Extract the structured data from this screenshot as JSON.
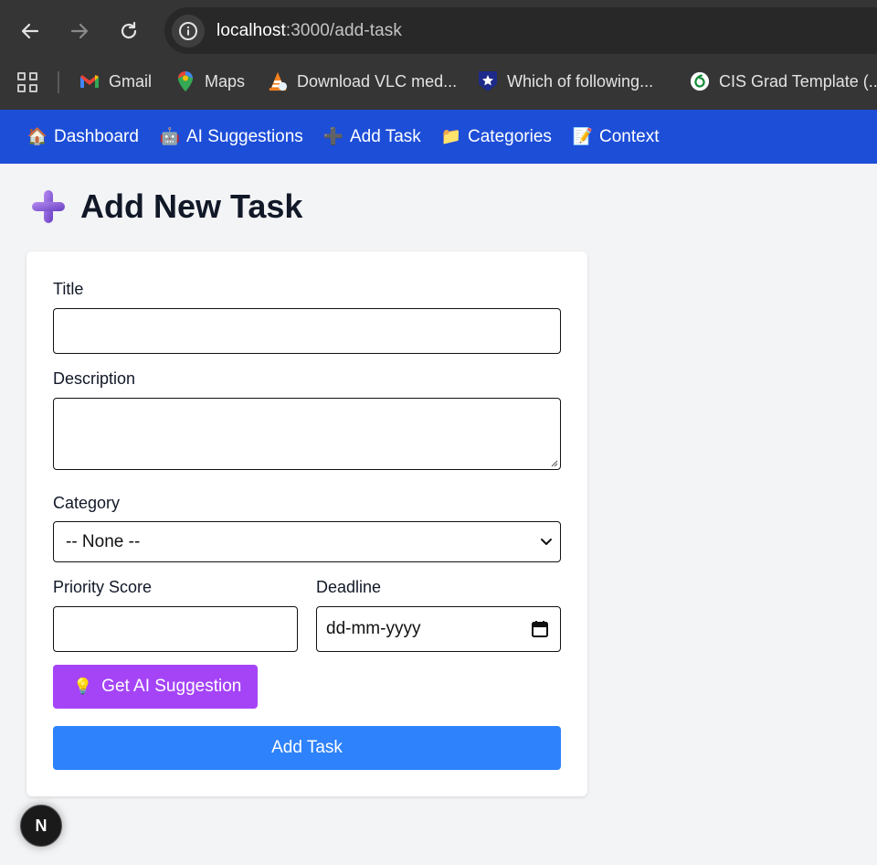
{
  "browser": {
    "url_host": "localhost",
    "url_path": ":3000/add-task",
    "bookmarks": [
      {
        "label": "Gmail",
        "icon": "gmail-icon"
      },
      {
        "label": "Maps",
        "icon": "maps-icon"
      },
      {
        "label": "Download VLC med...",
        "icon": "vlc-icon"
      },
      {
        "label": "Which of following...",
        "icon": "star-shield-icon"
      },
      {
        "label": "CIS Grad Template (...",
        "icon": "overleaf-icon"
      }
    ]
  },
  "appnav": {
    "items": [
      {
        "label": "Dashboard",
        "emoji": "🏠"
      },
      {
        "label": "AI Suggestions",
        "emoji": "🤖"
      },
      {
        "label": "Add Task",
        "emoji": "➕"
      },
      {
        "label": "Categories",
        "emoji": "📁"
      },
      {
        "label": "Context",
        "emoji": "📝"
      }
    ],
    "background": "#1d4ed8"
  },
  "page": {
    "title": "Add New Task"
  },
  "form": {
    "title_label": "Title",
    "title_value": "",
    "description_label": "Description",
    "description_value": "",
    "category_label": "Category",
    "category_value": "-- None --",
    "priority_label": "Priority Score",
    "priority_value": "",
    "deadline_label": "Deadline",
    "deadline_placeholder": "dd-mm-yyyy",
    "ai_button_label": "Get AI Suggestion",
    "ai_button_emoji": "💡",
    "ai_button_color": "#a544f7",
    "submit_label": "Add Task",
    "submit_color": "#2e82fb"
  },
  "next_badge": "N"
}
